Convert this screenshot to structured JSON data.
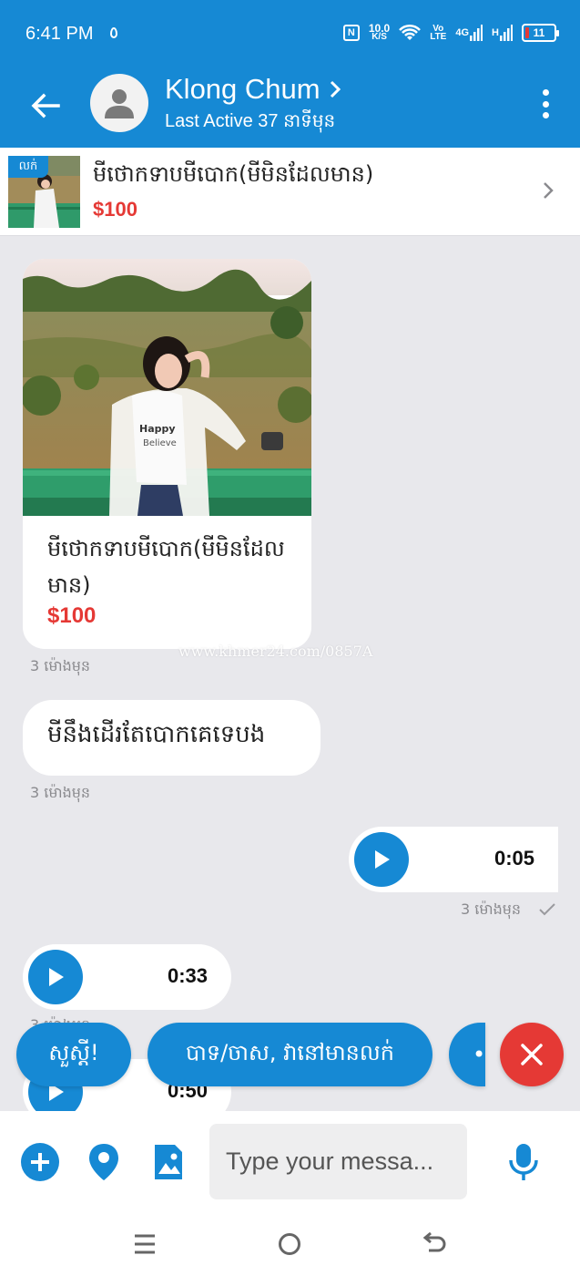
{
  "status_bar": {
    "time": "6:41 PM",
    "net_speed_value": "10.0",
    "net_speed_unit": "K/S",
    "volte_top": "Vo",
    "volte_bottom": "LTE",
    "network_4g": "4G",
    "network_h": "H",
    "battery": "11"
  },
  "header": {
    "contact_name": "Klong Chum",
    "last_active": "Last Active 37 នាទីមុន"
  },
  "product": {
    "tag": "លក់",
    "title": "មីថោកទាបមីបោក(មីមិនដែលមាន)",
    "price": "$100"
  },
  "messages": {
    "card_title": "មីថោកទាបមីបោក(មីមិនដែលមាន)",
    "card_price": "$100",
    "watermark": "www.khmer24.com/0857A",
    "card_time": "3 ម៉ោងមុន",
    "text_message": "មីនឹងដើរតែបោកគេទេបង",
    "text_time": "3 ម៉ោងមុន",
    "audio_out_duration": "0:05",
    "audio_out_time": "3 ម៉ោងមុន",
    "audio_in1_duration": "0:33",
    "audio_in1_time": "3 ម៉ោងមុន",
    "audio_in2_duration": "0:50"
  },
  "quick_replies": [
    "សួស្តី!",
    "បាទ/ចាស, វានៅមានលក់",
    "•"
  ],
  "input": {
    "placeholder": "Type your messa..."
  },
  "colors": {
    "primary": "#1689d4",
    "price": "#e53935",
    "close": "#e53935",
    "background": "#e8e8ec"
  }
}
